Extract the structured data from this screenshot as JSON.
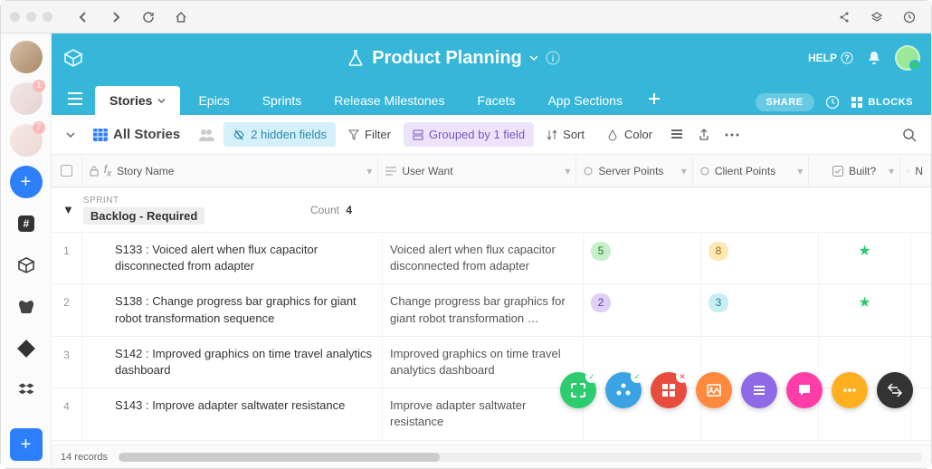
{
  "app": {
    "title": "Product Planning",
    "help_label": "HELP",
    "share_label": "SHARE",
    "blocks_label": "BLOCKS"
  },
  "avatars": [
    {
      "badge": ""
    },
    {
      "badge": "1"
    },
    {
      "badge": "7"
    }
  ],
  "tabs": [
    {
      "label": "Stories",
      "active": true
    },
    {
      "label": "Epics",
      "active": false
    },
    {
      "label": "Sprints",
      "active": false
    },
    {
      "label": "Release Milestones",
      "active": false
    },
    {
      "label": "Facets",
      "active": false
    },
    {
      "label": "App Sections",
      "active": false
    }
  ],
  "toolbar": {
    "view_name": "All Stories",
    "hidden_fields": "2 hidden fields",
    "filter": "Filter",
    "grouped": "Grouped by 1 field",
    "sort": "Sort",
    "color": "Color"
  },
  "columns": {
    "story_name": "Story Name",
    "user_want": "User Want",
    "server_points": "Server Points",
    "client_points": "Client Points",
    "built": "Built?",
    "n": "N"
  },
  "group": {
    "field_label": "SPRINT",
    "name": "Backlog - Required",
    "count_label": "Count",
    "count": "4"
  },
  "rows": [
    {
      "num": "1",
      "name": "S133 : Voiced alert when flux capacitor disconnected from adapter",
      "want": "Voiced alert when flux capacitor disconnected from adapter",
      "server": "5",
      "server_class": "p-green",
      "client": "8",
      "client_class": "p-yellow",
      "built": "★"
    },
    {
      "num": "2",
      "name": "S138 : Change progress bar graphics for giant robot transformation sequence",
      "want": "Change progress bar graphics for giant robot transformation …",
      "server": "2",
      "server_class": "p-purple",
      "client": "3",
      "client_class": "p-cyan",
      "built": "★"
    },
    {
      "num": "3",
      "name": "S142 : Improved graphics on time travel analytics dashboard",
      "want": "Improved graphics on time travel analytics dashboard",
      "server": "",
      "server_class": "",
      "client": "",
      "client_class": "",
      "built": ""
    },
    {
      "num": "4",
      "name": "S143 : Improve adapter saltwater resistance",
      "want": "Improve adapter saltwater resistance",
      "server": "",
      "server_class": "",
      "client": "",
      "client_class": "",
      "built": ""
    }
  ],
  "footer": {
    "records": "14 records"
  },
  "fabs": [
    {
      "color": "#2ecc71",
      "icon": "expand",
      "badge": "ok"
    },
    {
      "color": "#3aa3e3",
      "icon": "cluster",
      "badge": "ok"
    },
    {
      "color": "#e74c3c",
      "icon": "grid",
      "badge": "err"
    },
    {
      "color": "#ff8a3d",
      "icon": "image",
      "badge": ""
    },
    {
      "color": "#8e6ae6",
      "icon": "lines",
      "badge": ""
    },
    {
      "color": "#ff3da8",
      "icon": "chat",
      "badge": ""
    },
    {
      "color": "#ffb020",
      "icon": "dots",
      "badge": ""
    },
    {
      "color": "#333333",
      "icon": "arrows",
      "badge": ""
    }
  ]
}
